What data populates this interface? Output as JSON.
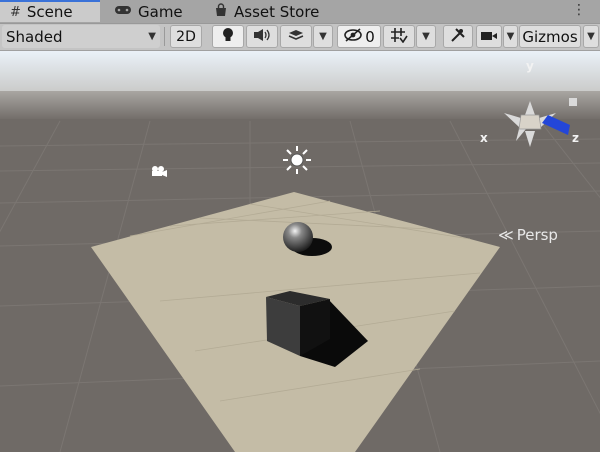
{
  "tabs": [
    {
      "label": "Scene",
      "icon": "grid-icon",
      "active": true
    },
    {
      "label": "Game",
      "icon": "gamepad-icon",
      "active": false
    },
    {
      "label": "Asset Store",
      "icon": "store-bag-icon",
      "active": false
    }
  ],
  "toolbar": {
    "shading_mode": "Shaded",
    "mode_2d": "2D",
    "hidden_count": "0",
    "gizmos_label": "Gizmos"
  },
  "scene_gizmo": {
    "projection_label": "Persp",
    "axis_y": "y",
    "axis_x": "x",
    "axis_z": "z"
  },
  "colors": {
    "ground": "#6f6a66",
    "plane": "#c4bca6",
    "sky": "#dce6ef",
    "active_tab_accent": "#3a72d8",
    "z_axis": "#2346d8"
  }
}
